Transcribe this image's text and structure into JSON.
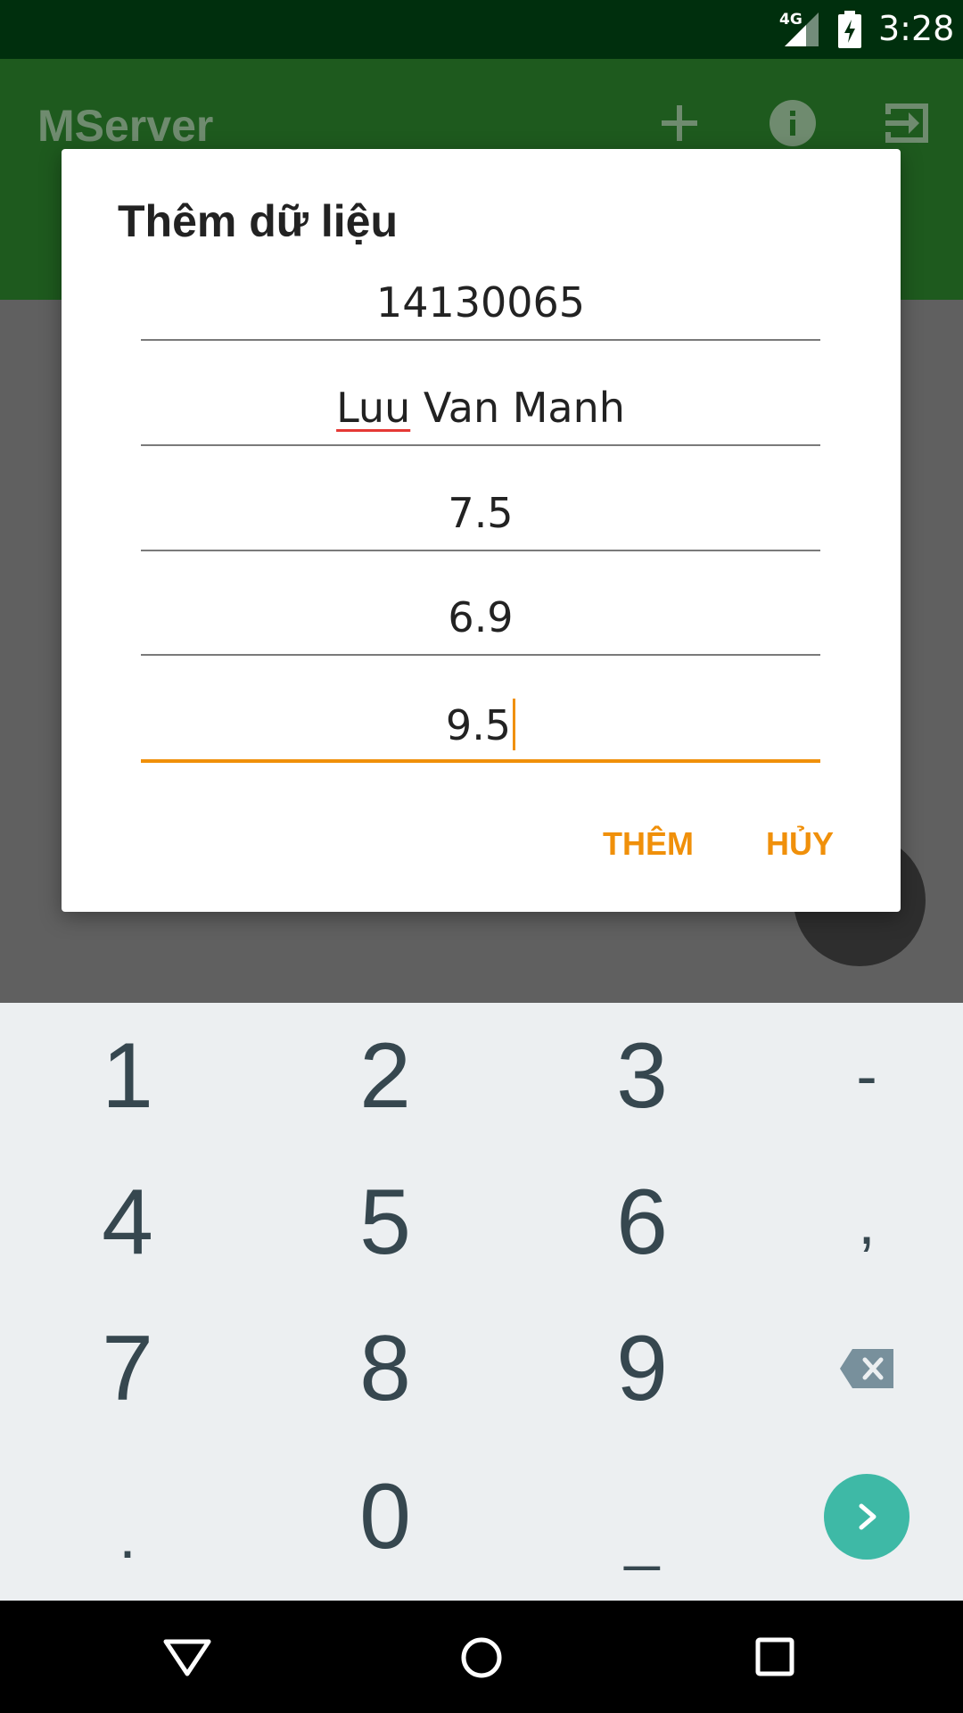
{
  "status_bar": {
    "network_label": "4G",
    "time": "3:28",
    "icons": [
      "signal-icon",
      "battery-charging-icon"
    ]
  },
  "app_bar": {
    "title": "MServer",
    "actions": [
      "add-icon",
      "info-icon",
      "exit-icon"
    ]
  },
  "dialog": {
    "title": "Thêm dữ liệu",
    "fields": [
      {
        "value": "14130065"
      },
      {
        "value_part1": "Luu",
        "value_part2": " Van Manh"
      },
      {
        "value": "7.5"
      },
      {
        "value": "6.9"
      },
      {
        "value": "9.5"
      }
    ],
    "add_label": "THÊM",
    "cancel_label": "HỦY"
  },
  "keyboard": {
    "rows": [
      [
        "1",
        "2",
        "3",
        "-"
      ],
      [
        "4",
        "5",
        "6",
        ","
      ],
      [
        "7",
        "8",
        "9",
        "backspace-icon"
      ],
      [
        ".",
        "0",
        "_",
        "enter-icon"
      ]
    ]
  },
  "colors": {
    "accent": "#f0900a",
    "app_bar": "#1e5a1e",
    "status_bar": "#002f0d",
    "enter_key": "#3eb9a6",
    "keyboard_bg": "#eceff1"
  }
}
